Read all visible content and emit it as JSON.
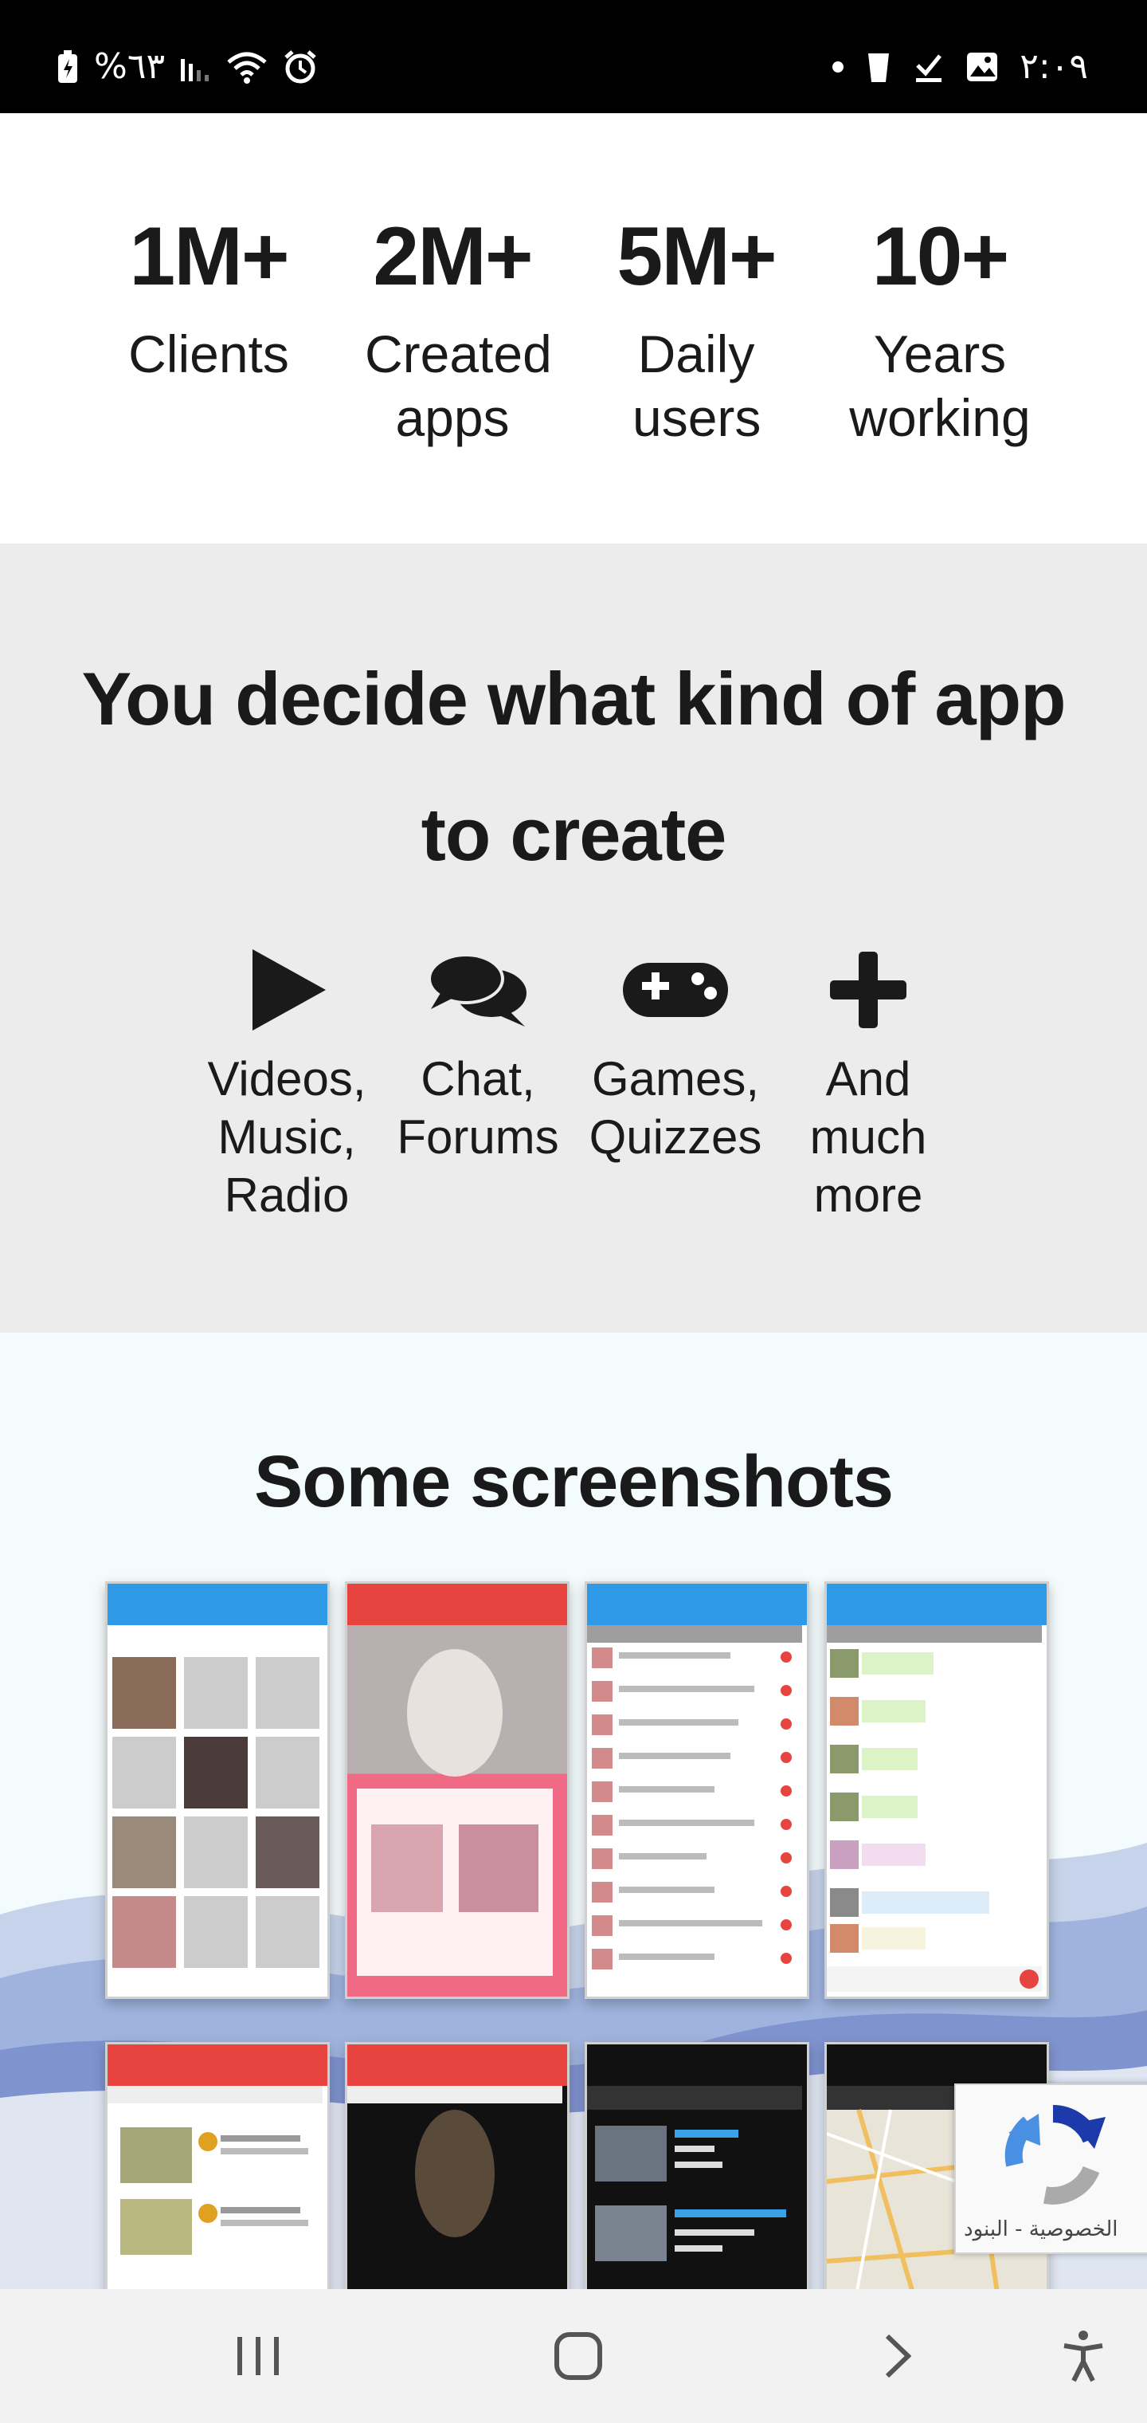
{
  "status_bar": {
    "battery": "%٦٣",
    "time": "٢:٠٩"
  },
  "stats": [
    {
      "value": "1M+",
      "label": "Clients"
    },
    {
      "value": "2M+",
      "label": "Created apps"
    },
    {
      "value": "5M+",
      "label": "Daily users"
    },
    {
      "value": "10+",
      "label": "Years working"
    }
  ],
  "app_kinds": {
    "title": "You decide what kind of app to create",
    "items": [
      {
        "icon": "play-icon",
        "label": "Videos, Music, Radio"
      },
      {
        "icon": "chat-bubbles-icon",
        "label": "Chat, Forums"
      },
      {
        "icon": "gamepad-icon",
        "label": "Games, Quizzes"
      },
      {
        "icon": "plus-icon",
        "label": "And much more"
      }
    ]
  },
  "screenshots": {
    "title": "Some screenshots"
  },
  "recaptcha": {
    "label": "الخصوصية - البنود"
  },
  "colors": {
    "blue_bar": "#2f9be8",
    "red_bar": "#e8443f",
    "dark": "#1a1a1a",
    "gray_section": "#ececec"
  }
}
